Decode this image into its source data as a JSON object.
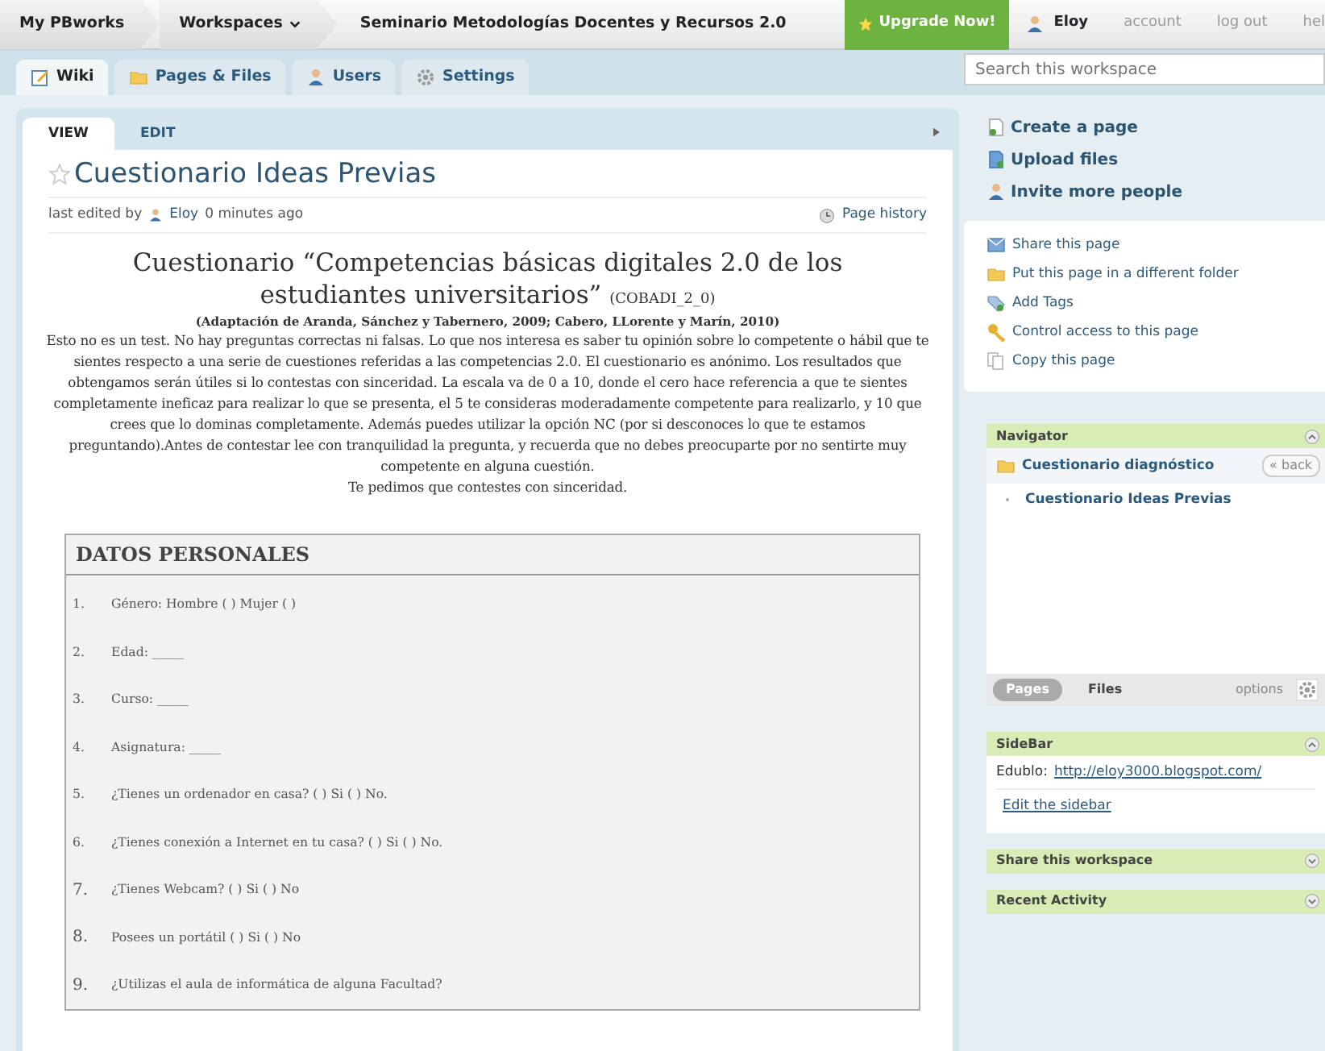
{
  "topbar": {
    "brand": "My PBworks",
    "workspaces": "Workspaces",
    "workspace_title": "Seminario Metodologías Docentes y Recursos 2.0",
    "upgrade": "Upgrade Now!",
    "user": "Eloy",
    "links": [
      "account",
      "log out",
      "hel"
    ]
  },
  "tabs": [
    {
      "label": "Wiki",
      "selected": true
    },
    {
      "label": "Pages & Files",
      "selected": false
    },
    {
      "label": "Users",
      "selected": false
    },
    {
      "label": "Settings",
      "selected": false
    }
  ],
  "search": {
    "placeholder": "Search this workspace"
  },
  "page_tabs": [
    {
      "label": "VIEW",
      "selected": true
    },
    {
      "label": "EDIT",
      "selected": false
    }
  ],
  "page": {
    "title": "Cuestionario Ideas Previas",
    "starred": false,
    "edited_prefix": "last edited by",
    "edited_user": "Eloy",
    "edited_suffix": "0 minutes ago",
    "history": "Page history"
  },
  "document": {
    "heading": "Cuestionario “Competencias básicas digitales 2.0 de los estudiantes universitarios”",
    "code": "(COBADI_2_0)",
    "source": "(Adaptación de Aranda, Sánchez y Tabernero, 2009; Cabero, LLorente y Marín, 2010)",
    "intro": "Esto no es un test. No hay preguntas correctas ni falsas. Lo que nos interesa es saber tu opinión sobre lo competente o hábil que te sientes respecto a una serie de cuestiones referidas a las competencias 2.0. El cuestionario es anónimo. Los resultados que obtengamos serán útiles si lo contestas con sinceridad. La escala va de 0 a 10, donde el cero hace referencia a que te sientes completamente ineficaz para realizar lo que se presenta, el 5 te consideras moderadamente competente para realizarlo, y 10 que crees que lo dominas completamente. Además puedes utilizar la opción NC (por si desconoces lo que te estamos preguntando).Antes de contestar lee con tranquilidad la pregunta, y recuerda que no debes preocuparte por no sentirte muy competente en alguna cuestión.",
    "closing": "Te pedimos que contestes con sinceridad.",
    "section": "DATOS PERSONALES",
    "items": [
      {
        "number": "1.",
        "text": "Género: Hombre ( ) Mujer ( )"
      },
      {
        "number": "2.",
        "text": "Edad: _____"
      },
      {
        "number": "3.",
        "text": "Curso: _____"
      },
      {
        "number": "4.",
        "text": "Asignatura: _____"
      },
      {
        "number": "5.",
        "text": "¿Tienes un ordenador en casa? ( ) Si ( ) No."
      },
      {
        "number": "6.",
        "text": "¿Tienes conexión a Internet en tu casa? ( ) Si ( ) No."
      },
      {
        "number": "7.",
        "text": "¿Tienes Webcam? ( ) Si ( ) No"
      },
      {
        "number": "8.",
        "text": "Posees un portátil ( ) Si ( ) No"
      },
      {
        "number": "9.",
        "text": "¿Utilizas el aula de informática de alguna Facultad?"
      }
    ]
  },
  "actions": [
    "Create a page",
    "Upload files",
    "Invite more people"
  ],
  "page_actions": [
    "Share this page",
    "Put this page in a different folder",
    "Add Tags",
    "Control access to this page",
    "Copy this page"
  ],
  "navigator": {
    "title": "Navigator",
    "expanded": true,
    "folder": "Cuestionario diagnóstico",
    "back": "« back",
    "pages": [
      "Cuestionario Ideas Previas"
    ],
    "panes": [
      {
        "label": "Pages",
        "selected": true
      },
      {
        "label": "Files",
        "selected": false
      }
    ],
    "options": "options"
  },
  "sidebar_widget": {
    "title": "SideBar",
    "expanded": true,
    "prefix": "Edublo:",
    "link": "http://eloy3000.blogspot.com/",
    "edit": "Edit the sidebar"
  },
  "panels": [
    {
      "title": "Share this workspace",
      "expanded": false
    },
    {
      "title": "Recent Activity",
      "expanded": false
    }
  ]
}
